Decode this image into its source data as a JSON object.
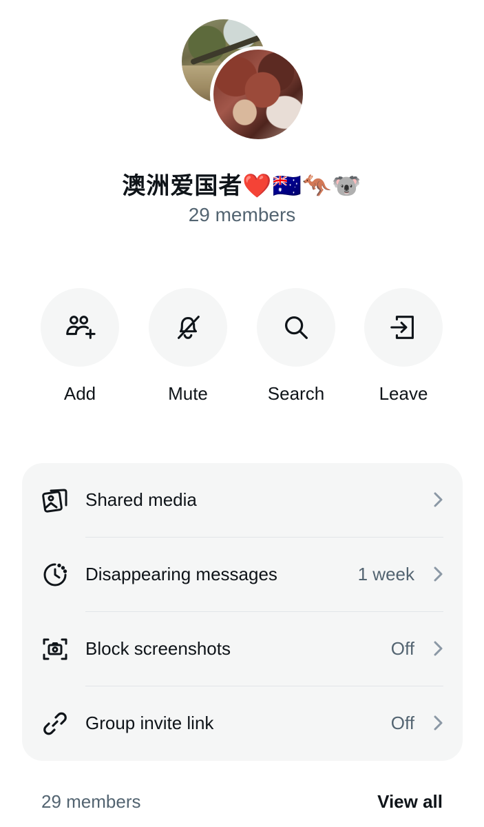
{
  "group": {
    "title": "澳洲爱国者❤️🇦🇺🦘🐨",
    "member_count": "29 members"
  },
  "actions": [
    {
      "label": "Add",
      "icon": "add-users-icon"
    },
    {
      "label": "Mute",
      "icon": "bell-off-icon"
    },
    {
      "label": "Search",
      "icon": "search-icon"
    },
    {
      "label": "Leave",
      "icon": "leave-icon"
    }
  ],
  "settings": [
    {
      "label": "Shared media",
      "value": "",
      "icon": "media-icon"
    },
    {
      "label": "Disappearing messages",
      "value": "1 week",
      "icon": "timer-icon"
    },
    {
      "label": "Block screenshots",
      "value": "Off",
      "icon": "screenshot-icon"
    },
    {
      "label": "Group invite link",
      "value": "Off",
      "icon": "link-icon"
    }
  ],
  "footer": {
    "member_count": "29 members",
    "view_all": "View all"
  },
  "colors": {
    "text_primary": "#0f1419",
    "text_secondary": "#536471",
    "card_background": "#f5f6f6"
  }
}
